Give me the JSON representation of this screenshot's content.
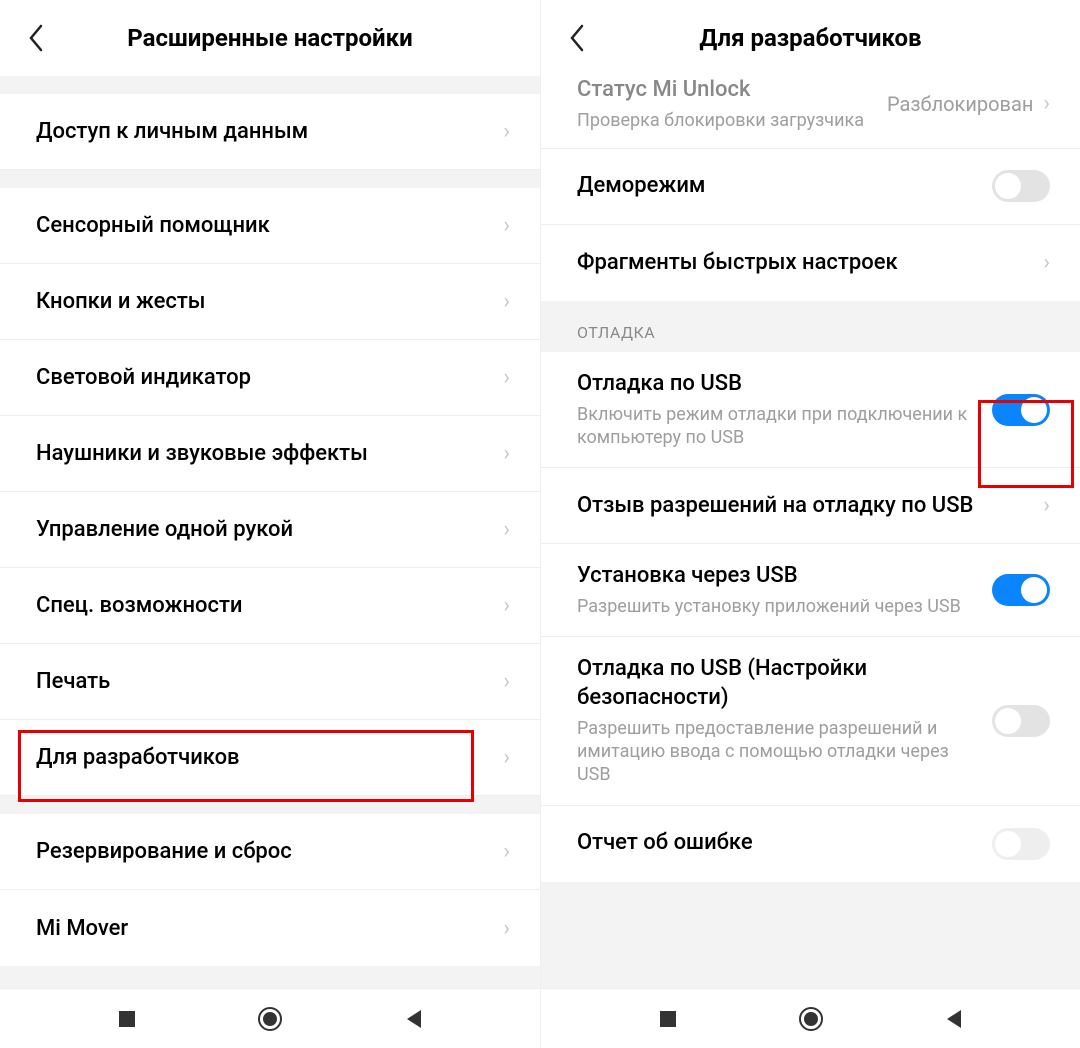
{
  "left": {
    "header_title": "Расширенные настройки",
    "items": [
      {
        "label": "Доступ к личным данным"
      },
      {
        "label": "Сенсорный помощник"
      },
      {
        "label": "Кнопки и жесты"
      },
      {
        "label": "Световой индикатор"
      },
      {
        "label": "Наушники и звуковые эффекты"
      },
      {
        "label": "Управление одной рукой"
      },
      {
        "label": "Спец. возможности"
      },
      {
        "label": "Печать"
      },
      {
        "label": "Для разработчиков"
      },
      {
        "label": "Резервирование и сброс"
      },
      {
        "label": "Mi Mover"
      }
    ]
  },
  "right": {
    "header_title": "Для разработчиков",
    "partial_top": {
      "title": "Статус Mi Unlock",
      "sub": "Проверка блокировки загрузчика",
      "value": "Разблокирован"
    },
    "items_a": [
      {
        "title": "Деморежим",
        "toggle": "off"
      },
      {
        "title": "Фрагменты быстрых настроек",
        "chevron": true
      }
    ],
    "section_debug": "ОТЛАДКА",
    "items_b": [
      {
        "title": "Отладка по USB",
        "sub": "Включить режим отладки при подключении к компьютеру по USB",
        "toggle": "on",
        "highlighted": true
      },
      {
        "title": "Отзыв разрешений на отладку по USB",
        "chevron": true
      },
      {
        "title": "Установка через USB",
        "sub": "Разрешить установку приложений через USB",
        "toggle": "on"
      },
      {
        "title": "Отладка по USB (Настройки безопасности)",
        "sub": "Разрешить предоставление разрешений и имитацию ввода с помощью отладки через USB",
        "toggle": "off"
      },
      {
        "title": "Отчет об ошибке",
        "toggle": "off"
      }
    ]
  }
}
